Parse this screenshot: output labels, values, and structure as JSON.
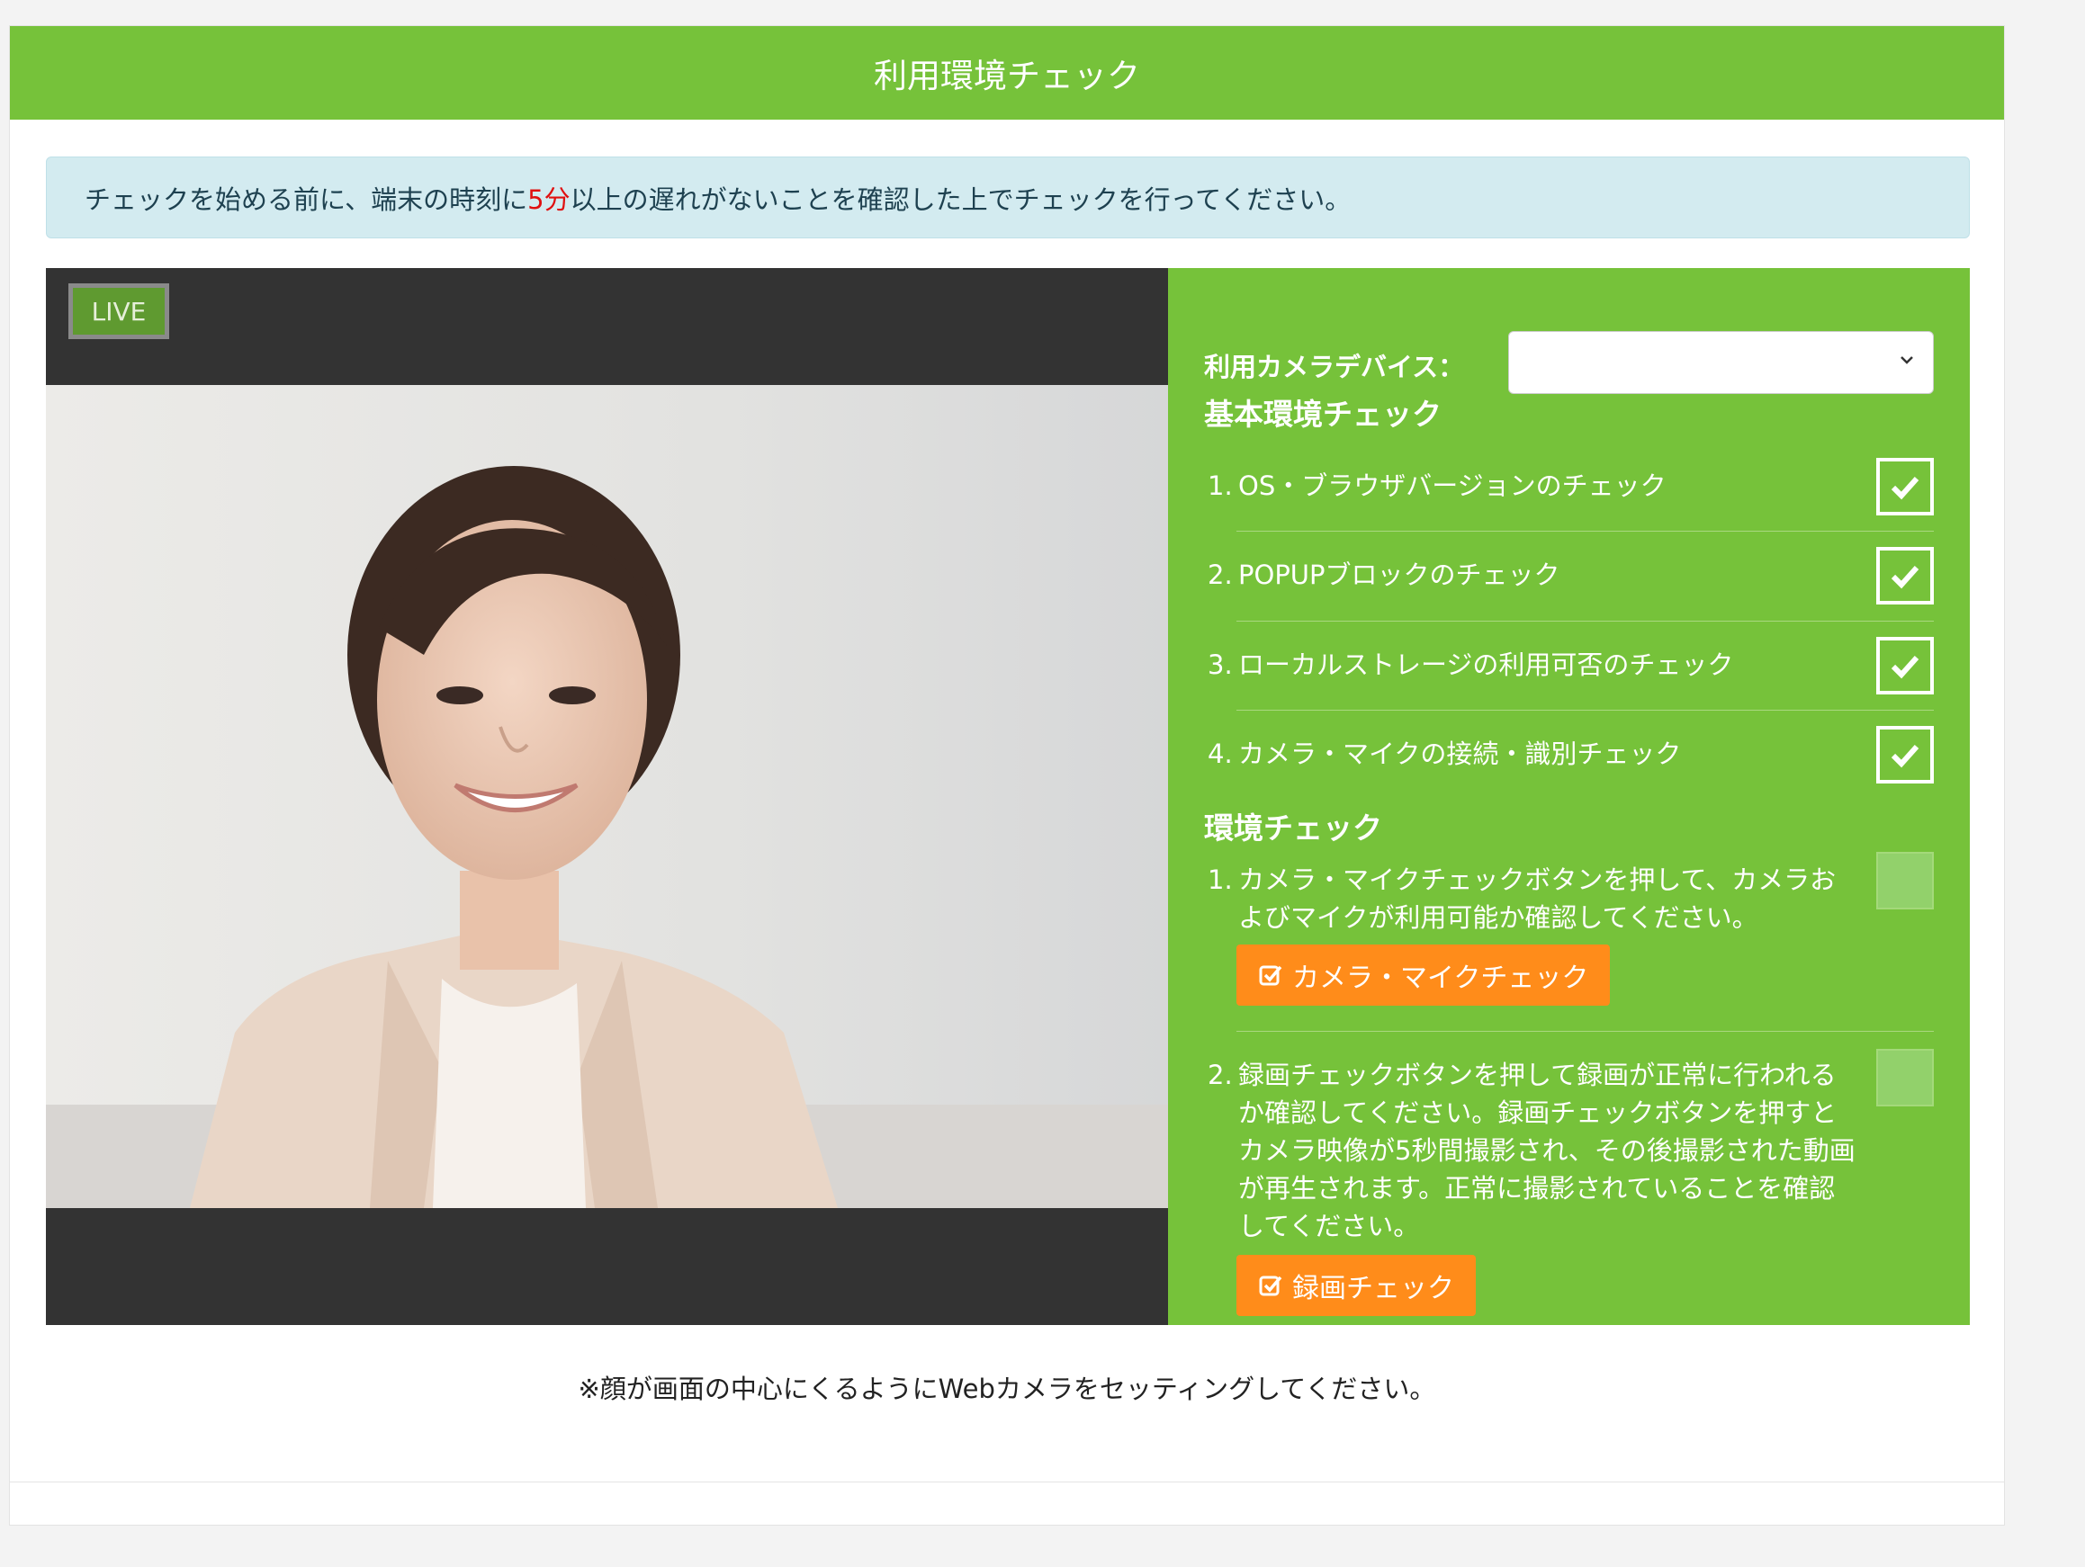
{
  "header": {
    "title": "利用環境チェック"
  },
  "notice": {
    "before": "チェックを始める前に、端末の時刻に",
    "highlight": "5分",
    "after": "以上の遅れがないことを確認した上でチェックを行ってください。"
  },
  "video": {
    "live_label": "LIVE"
  },
  "camera_device": {
    "label": "利用カメラデバイス：",
    "selected": ""
  },
  "basic_check": {
    "title": "基本環境チェック",
    "items": [
      {
        "num": "1.",
        "text": "OS・ブラウザバージョンのチェック",
        "checked": true
      },
      {
        "num": "2.",
        "text": "POPUPブロックのチェック",
        "checked": true
      },
      {
        "num": "3.",
        "text": "ローカルストレージの利用可否のチェック",
        "checked": true
      },
      {
        "num": "4.",
        "text": "カメラ・マイクの接続・識別チェック",
        "checked": true
      }
    ]
  },
  "env_check": {
    "title": "環境チェック",
    "items": [
      {
        "num": "1.",
        "text": "カメラ・マイクチェックボタンを押して、カメラおよびマイクが利用可能か確認してください。",
        "button": "カメラ・マイクチェック",
        "checked": false
      },
      {
        "num": "2.",
        "text": "録画チェックボタンを押して録画が正常に行われるか確認してください。録画チェックボタンを押すとカメラ映像が5秒間撮影され、その後撮影された動画が再生されます。正常に撮影されていることを確認してください。",
        "button": "録画チェック",
        "checked": false
      }
    ]
  },
  "footer": {
    "note": "※顔が画面の中心にくるようにWebカメラをセッティングしてください。"
  },
  "colors": {
    "brand_green": "#76c23a",
    "button_orange": "#ff8c1a",
    "notice_bg": "#d3ebf0",
    "video_bg": "#333333"
  }
}
